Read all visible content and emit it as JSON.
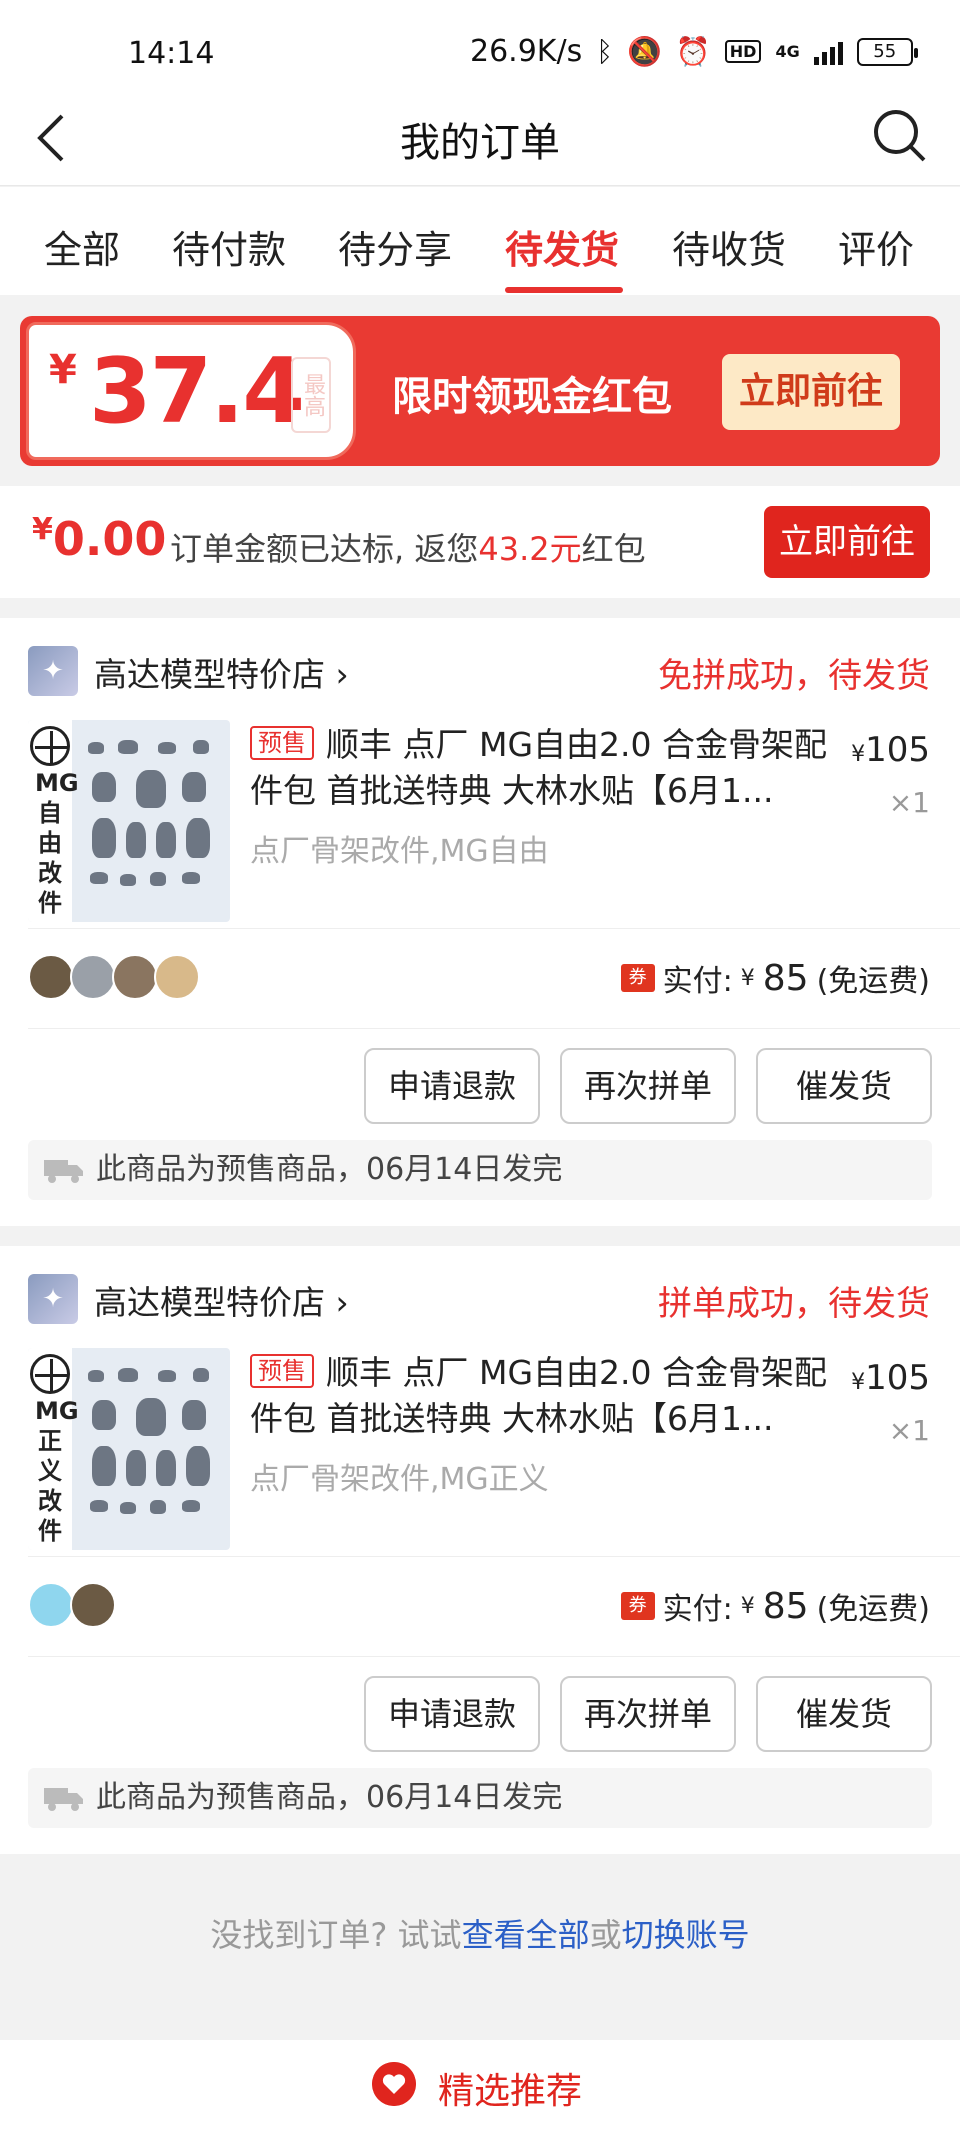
{
  "status_bar": {
    "time": "14:14",
    "net_speed": "26.9K/s",
    "network": "4G",
    "battery": "55"
  },
  "nav": {
    "title": "我的订单",
    "back_icon": "back-chevron-icon",
    "search_icon": "search-icon"
  },
  "tabs": [
    {
      "label": "全部",
      "active": false
    },
    {
      "label": "待付款",
      "active": false
    },
    {
      "label": "待分享",
      "active": false
    },
    {
      "label": "待发货",
      "active": true
    },
    {
      "label": "待收货",
      "active": false
    },
    {
      "label": "评价",
      "active": false
    }
  ],
  "banner": {
    "currency": "¥",
    "amount": "37.4",
    "tag": "最高",
    "text": "限时领现金红包",
    "button": "立即前往"
  },
  "rebate": {
    "currency": "¥",
    "amount": "0.00",
    "text_prefix": "订单金额已达标, 返您",
    "text_highlight": "43.2元",
    "text_suffix": "红包",
    "button": "立即前往"
  },
  "orders": [
    {
      "shop_name": "高达模型特价店",
      "shop_chevron": "›",
      "status": "免拼成功，待发货",
      "thumb_label": "MG自由改件",
      "tag": "预售",
      "title": "顺丰 点厂  MG自由2.0 合金骨架配件包 首批送特典 大林水贴【6月1...",
      "spec": "点厂骨架改件,MG自由",
      "price_yen": "¥",
      "price": "105",
      "qty": "×1",
      "pay_label": "实付:",
      "pay_yen": "¥",
      "pay_amount": "85",
      "pay_note": "(免运费)",
      "coupon": "券",
      "buttons": [
        "申请退款",
        "再次拼单",
        "催发货"
      ],
      "notice": "此商品为预售商品，06月14日发完"
    },
    {
      "shop_name": "高达模型特价店",
      "shop_chevron": "›",
      "status": "拼单成功，待发货",
      "thumb_label": "MG正义改件",
      "tag": "预售",
      "title": "顺丰 点厂  MG自由2.0 合金骨架配件包 首批送特典 大林水贴【6月1...",
      "spec": "点厂骨架改件,MG正义",
      "price_yen": "¥",
      "price": "105",
      "qty": "×1",
      "pay_label": "实付:",
      "pay_yen": "¥",
      "pay_amount": "85",
      "pay_note": "(免运费)",
      "coupon": "券",
      "buttons": [
        "申请退款",
        "再次拼单",
        "催发货"
      ],
      "notice": "此商品为预售商品，06月14日发完"
    }
  ],
  "footer": {
    "prefix": "没找到订单? 试试",
    "link1": "查看全部",
    "middle": "或",
    "link2": "切换账号"
  },
  "recommend": {
    "title": "精选推荐"
  },
  "colors": {
    "accent": "#e8312f",
    "link": "#2b5fc7"
  }
}
